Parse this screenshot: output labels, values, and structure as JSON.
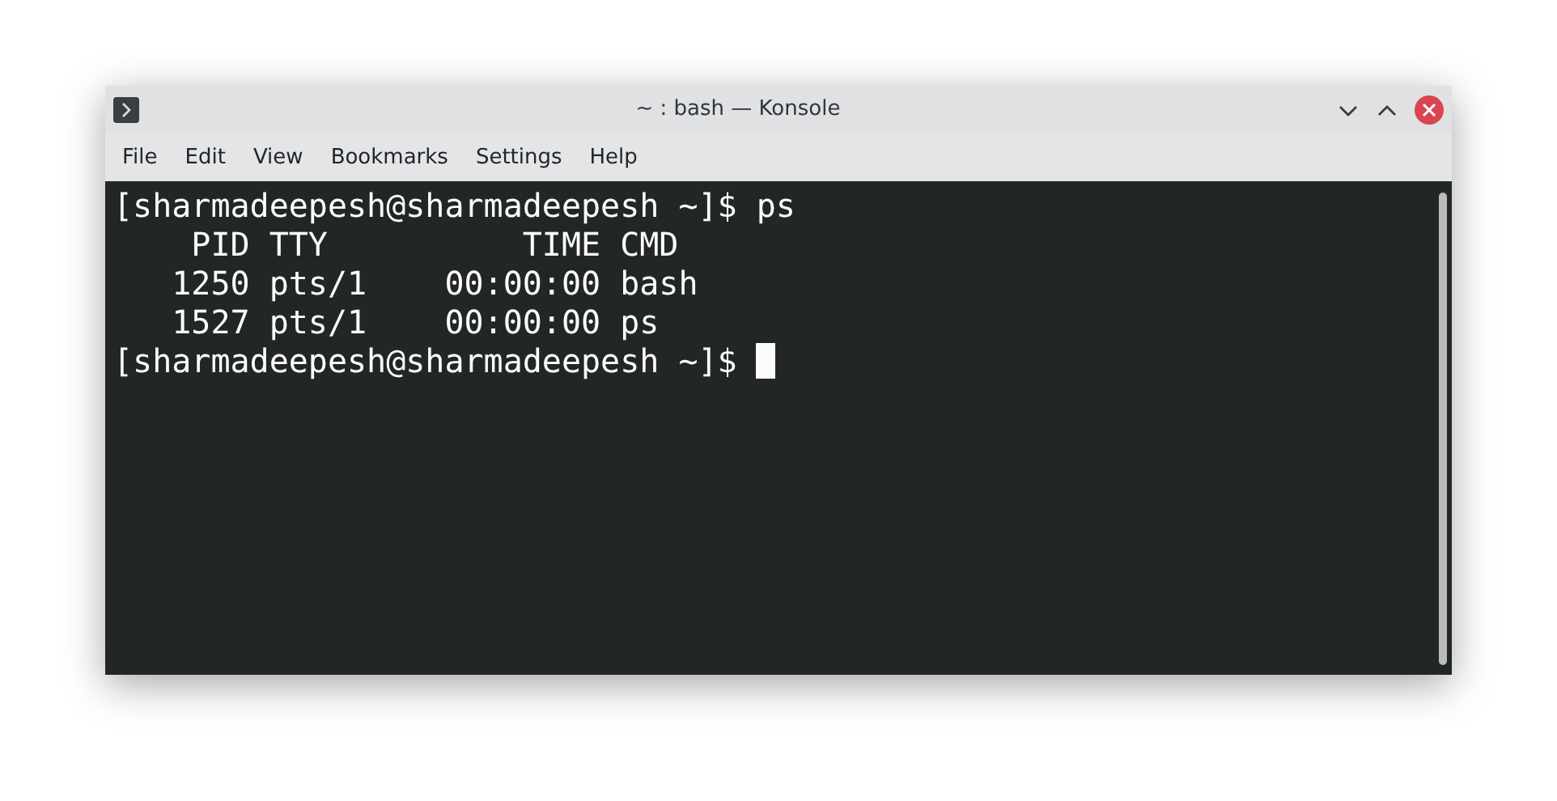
{
  "window": {
    "title": "~ : bash — Konsole"
  },
  "menu": [
    "File",
    "Edit",
    "View",
    "Bookmarks",
    "Settings",
    "Help"
  ],
  "terminal": {
    "lines": [
      "[sharmadeepesh@sharmadeepesh ~]$ ps",
      "    PID TTY          TIME CMD",
      "   1250 pts/1    00:00:00 bash",
      "   1527 pts/1    00:00:00 ps",
      "[sharmadeepesh@sharmadeepesh ~]$ "
    ],
    "cursor": true
  }
}
